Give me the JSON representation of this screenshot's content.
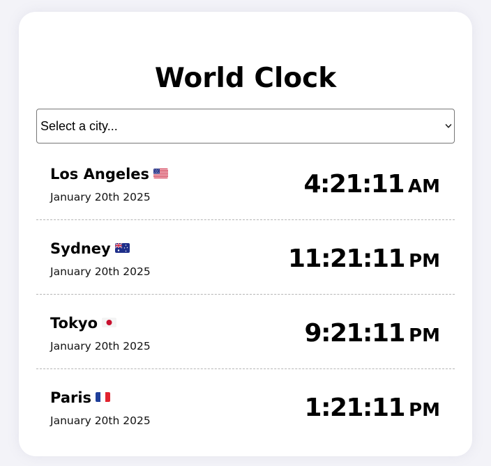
{
  "title": "World Clock",
  "city_select": {
    "value": "Select a city..."
  },
  "clocks": [
    {
      "city": "Los Angeles",
      "flag": "us-flag-icon",
      "date": "January 20th 2025",
      "time": "4:21:11",
      "period": "AM"
    },
    {
      "city": "Sydney",
      "flag": "au-flag-icon",
      "date": "January 20th 2025",
      "time": "11:21:11",
      "period": "PM"
    },
    {
      "city": "Tokyo",
      "flag": "jp-flag-icon",
      "date": "January 20th 2025",
      "time": "9:21:11",
      "period": "PM"
    },
    {
      "city": "Paris",
      "flag": "fr-flag-icon",
      "date": "January 20th 2025",
      "time": "1:21:11",
      "period": "PM"
    }
  ],
  "colors": {
    "background": "#f3f3f8",
    "card": "#ffffff",
    "text": "#000000",
    "divider": "#b5b5b5"
  }
}
